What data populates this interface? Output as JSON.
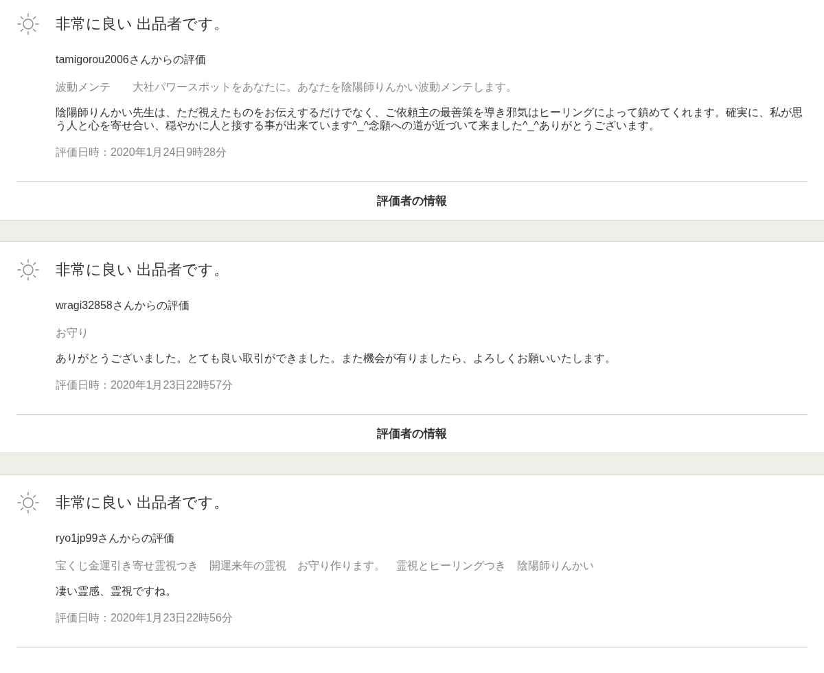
{
  "reviews": [
    {
      "rating": "非常に良い 出品者です。",
      "reviewer": "tamigorou2006さんからの評価",
      "item": "波動メンテ　　大社パワースポットをあなたに。あなたを陰陽師りんかい波動メンテします。",
      "comment": "陰陽師りんかい先生は、ただ視えたものをお伝えするだけでなく、ご依頼主の最善策を導き邪気はヒーリングによって鎮めてくれます。確実に、私が思う人と心を寄せ合い、穏やかに人と接する事が出来ています^_^念願への道が近づいて来ました^_^ありがとうございます。",
      "date": "評価日時：2020年1月24日9時28分",
      "reviewer_info": "評価者の情報"
    },
    {
      "rating": "非常に良い 出品者です。",
      "reviewer": "wragi32858さんからの評価",
      "item": "お守り",
      "comment": "ありがとうございました。とても良い取引ができました。また機会が有りましたら、よろしくお願いいたします。",
      "date": "評価日時：2020年1月23日22時57分",
      "reviewer_info": "評価者の情報"
    },
    {
      "rating": "非常に良い 出品者です。",
      "reviewer": "ryo1jp99さんからの評価",
      "item": "宝くじ金運引き寄せ霊視つき　開運来年の霊視　お守り作ります。　霊視とヒーリングつき　陰陽師りんかい",
      "comment": "凄い霊感、霊視ですね。",
      "date": "評価日時：2020年1月23日22時56分"
    }
  ]
}
